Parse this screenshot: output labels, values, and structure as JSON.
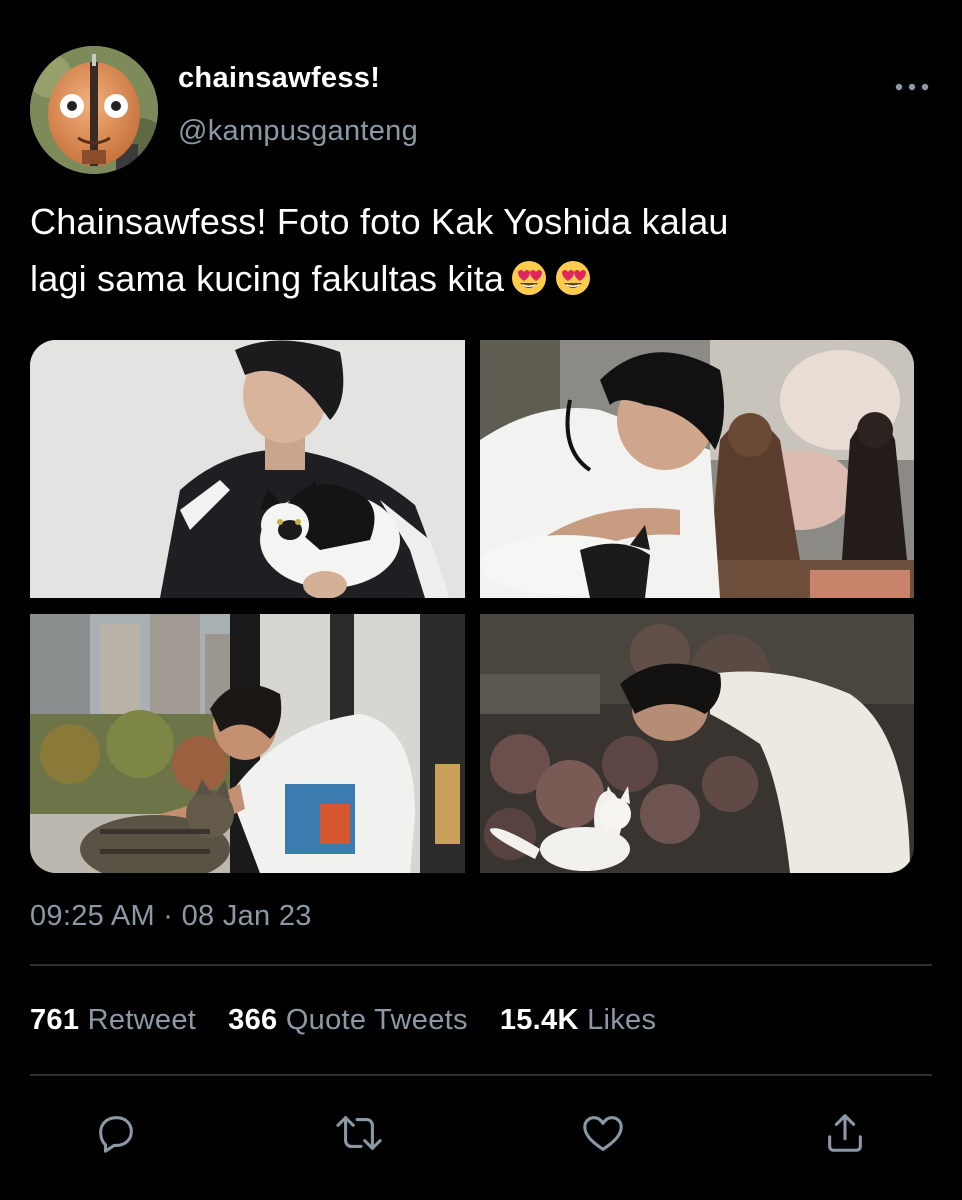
{
  "tweet": {
    "display_name": "chainsawfess!",
    "handle": "@kampusganteng",
    "text_line1": "Chainsawfess! Foto foto Kak Yoshida kalau",
    "text_line2": "lagi sama kucing fakultas kita",
    "emojis": [
      "heart-eyes-emoji",
      "heart-eyes-emoji"
    ],
    "timestamp": "09:25 AM · 08 Jan 23"
  },
  "media": {
    "photos": [
      "photo-man-in-track-jacket-holding-black-white-cat",
      "photo-man-petting-cat-near-statues",
      "photo-man-petting-tabby-cat-by-window",
      "photo-man-bowing-to-white-cat-among-flowers"
    ]
  },
  "stats": {
    "retweets_count": "761",
    "retweets_label": "Retweet",
    "quotes_count": "366",
    "quotes_label": "Quote Tweets",
    "likes_count": "15.4K",
    "likes_label": "Likes"
  },
  "icons": {
    "reply": "reply-icon",
    "retweet": "retweet-icon",
    "like": "heart-icon",
    "share": "share-icon",
    "more": "more-icon"
  },
  "colors": {
    "background": "#000000",
    "primary_text": "#ffffff",
    "secondary_text": "#8b98a5",
    "divider": "#2b2f33"
  }
}
